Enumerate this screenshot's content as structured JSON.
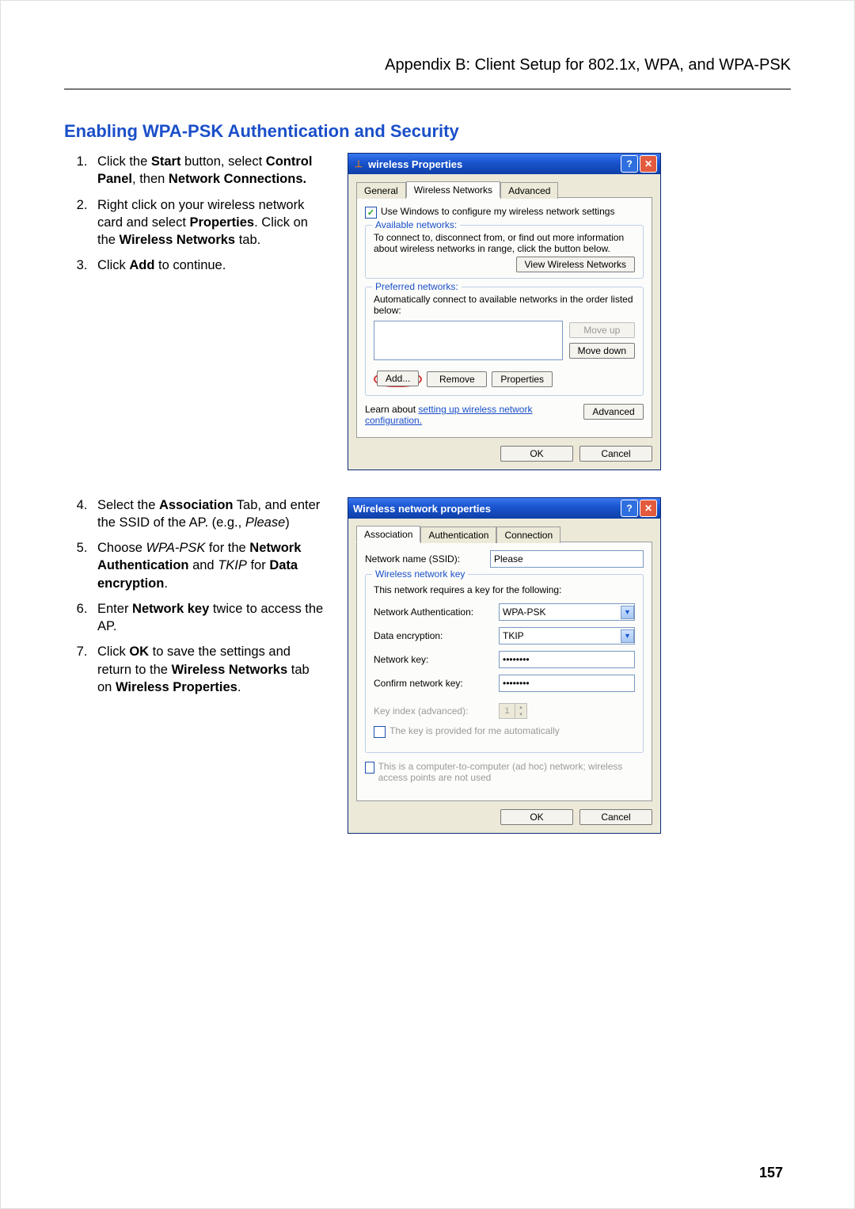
{
  "header": "Appendix B: Client Setup for 802.1x, WPA, and WPA-PSK",
  "sectionTitle": "Enabling WPA-PSK Authentication and Security",
  "steps1": {
    "s1a": "Click the ",
    "s1b": "Start",
    "s1c": " button, select ",
    "s1d": "Control Panel",
    "s1e": ", then ",
    "s1f": "Network Connections.",
    "s2a": "Right click on your wireless network card and select ",
    "s2b": "Properties",
    "s2c": ". Click on the ",
    "s2d": "Wireless Networks",
    "s2e": " tab.",
    "s3a": "Click ",
    "s3b": "Add",
    "s3c": " to continue."
  },
  "steps2": {
    "s4a": "Select the ",
    "s4b": "Association",
    "s4c": " Tab, and enter the SSID of the AP. (e.g., ",
    "s4d": "Please",
    "s4e": ")",
    "s5a": "Choose ",
    "s5b": "WPA-PSK",
    "s5c": " for the ",
    "s5d": "Network Authentication",
    "s5e": " and ",
    "s5f": "TKIP",
    "s5g": " for ",
    "s5h": "Data encryption",
    "s5i": ".",
    "s6a": "Enter ",
    "s6b": "Network key",
    "s6c": " twice to access the AP.",
    "s7a": "Click ",
    "s7b": "OK",
    "s7c": " to save the settings and return to the ",
    "s7d": "Wireless Networks",
    "s7e": " tab on ",
    "s7f": "Wireless Properties",
    "s7g": "."
  },
  "dlg1": {
    "title": "wireless Properties",
    "tabs": {
      "general": "General",
      "wn": "Wireless Networks",
      "adv": "Advanced"
    },
    "useWindows": "Use Windows to configure my wireless network settings",
    "availLegend": "Available networks:",
    "availText": "To connect to, disconnect from, or find out more information about wireless networks in range, click the button below.",
    "viewBtn": "View Wireless Networks",
    "prefLegend": "Preferred networks:",
    "prefText": "Automatically connect to available networks in the order listed below:",
    "moveUp": "Move up",
    "moveDown": "Move down",
    "add": "Add...",
    "remove": "Remove",
    "props": "Properties",
    "learnA": "Learn about ",
    "learnB": "setting up wireless network configuration.",
    "advanced": "Advanced",
    "ok": "OK",
    "cancel": "Cancel"
  },
  "dlg2": {
    "title": "Wireless network properties",
    "tabs": {
      "assoc": "Association",
      "auth": "Authentication",
      "conn": "Connection"
    },
    "ssidLabel": "Network name (SSID):",
    "ssidValue": "Please",
    "keyLegend": "Wireless network key",
    "keyText": "This network requires a key for the following:",
    "naLabel": "Network Authentication:",
    "naValue": "WPA-PSK",
    "deLabel": "Data encryption:",
    "deValue": "TKIP",
    "nkLabel": "Network key:",
    "nkValue": "••••••••",
    "cnkLabel": "Confirm network key:",
    "cnkValue": "••••••••",
    "kiLabel": "Key index (advanced):",
    "kiValue": "1",
    "autoKey": "The key is provided for me automatically",
    "adhoc": "This is a computer-to-computer (ad hoc) network; wireless access points are not used",
    "ok": "OK",
    "cancel": "Cancel"
  },
  "pageNumber": "157"
}
